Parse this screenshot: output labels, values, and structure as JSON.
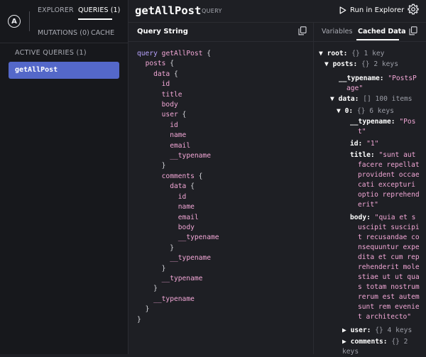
{
  "sidebar": {
    "logo": "A",
    "tabs": {
      "explorer": "EXPLORER",
      "queries": "QUERIES (1)",
      "mutations": "MUTATIONS (0)",
      "cache": "CACHE"
    },
    "active_queries_label": "ACTIVE QUERIES (1)",
    "queries": [
      {
        "label": "getAllPost"
      }
    ]
  },
  "header": {
    "title": "getAllPost",
    "title_tag": "QUERY",
    "run_label": "Run in Explorer"
  },
  "query_pane": {
    "title": "Query String",
    "code": [
      [
        "query getAllPost {",
        ""
      ],
      [
        "  posts {",
        ""
      ],
      [
        "    data {",
        ""
      ],
      [
        "      id",
        ""
      ],
      [
        "      title",
        ""
      ],
      [
        "      body",
        ""
      ],
      [
        "      user {",
        ""
      ],
      [
        "        id",
        ""
      ],
      [
        "        name",
        ""
      ],
      [
        "        email",
        ""
      ],
      [
        "        __typename",
        ""
      ],
      [
        "      }",
        ""
      ],
      [
        "      comments {",
        ""
      ],
      [
        "        data {",
        ""
      ],
      [
        "          id",
        ""
      ],
      [
        "          name",
        ""
      ],
      [
        "          email",
        ""
      ],
      [
        "          body",
        ""
      ],
      [
        "          __typename",
        ""
      ],
      [
        "        }",
        ""
      ],
      [
        "        __typename",
        ""
      ],
      [
        "      }",
        ""
      ],
      [
        "      __typename",
        ""
      ],
      [
        "    }",
        ""
      ],
      [
        "    __typename",
        ""
      ],
      [
        "  }",
        ""
      ],
      [
        "}",
        ""
      ]
    ]
  },
  "cache_pane": {
    "tabs": {
      "variables": "Variables",
      "cached": "Cached Data"
    },
    "root_key": "root:",
    "root_meta": "{} 1 key",
    "posts_key": "posts:",
    "posts_meta": "{} 2 keys",
    "posts_typename_key": "__typename:",
    "posts_typename_val_1": "\"PostsP",
    "posts_typename_val_2": "age\"",
    "data_key": "data:",
    "data_meta": "[] 100 items",
    "item0_key": "0:",
    "item0_meta": "{} 6 keys",
    "item_typename_key": "__typename:",
    "item_typename_val_1": "\"Pos",
    "item_typename_val_2": "t\"",
    "id_key": "id:",
    "id_val": "\"1\"",
    "title_key": "title:",
    "title_lines": [
      "\"sunt aut",
      "facere repellat",
      "provident occae",
      "cati excepturi",
      "optio reprehend",
      "erit\""
    ],
    "body_key": "body:",
    "body_lines": [
      "\"quia et s",
      "uscipit suscipi",
      "t recusandae co",
      "nsequuntur expe",
      "dita et cum rep",
      "rehenderit mole",
      "stiae ut ut qua",
      "s totam nostrum",
      "rerum est autem",
      "sunt rem evenie",
      "t architecto\""
    ],
    "user_key": "user:",
    "user_meta": "{} 4 keys",
    "comments_key": "comments:",
    "comments_meta_1": "{} 2",
    "comments_meta_2": "keys"
  }
}
